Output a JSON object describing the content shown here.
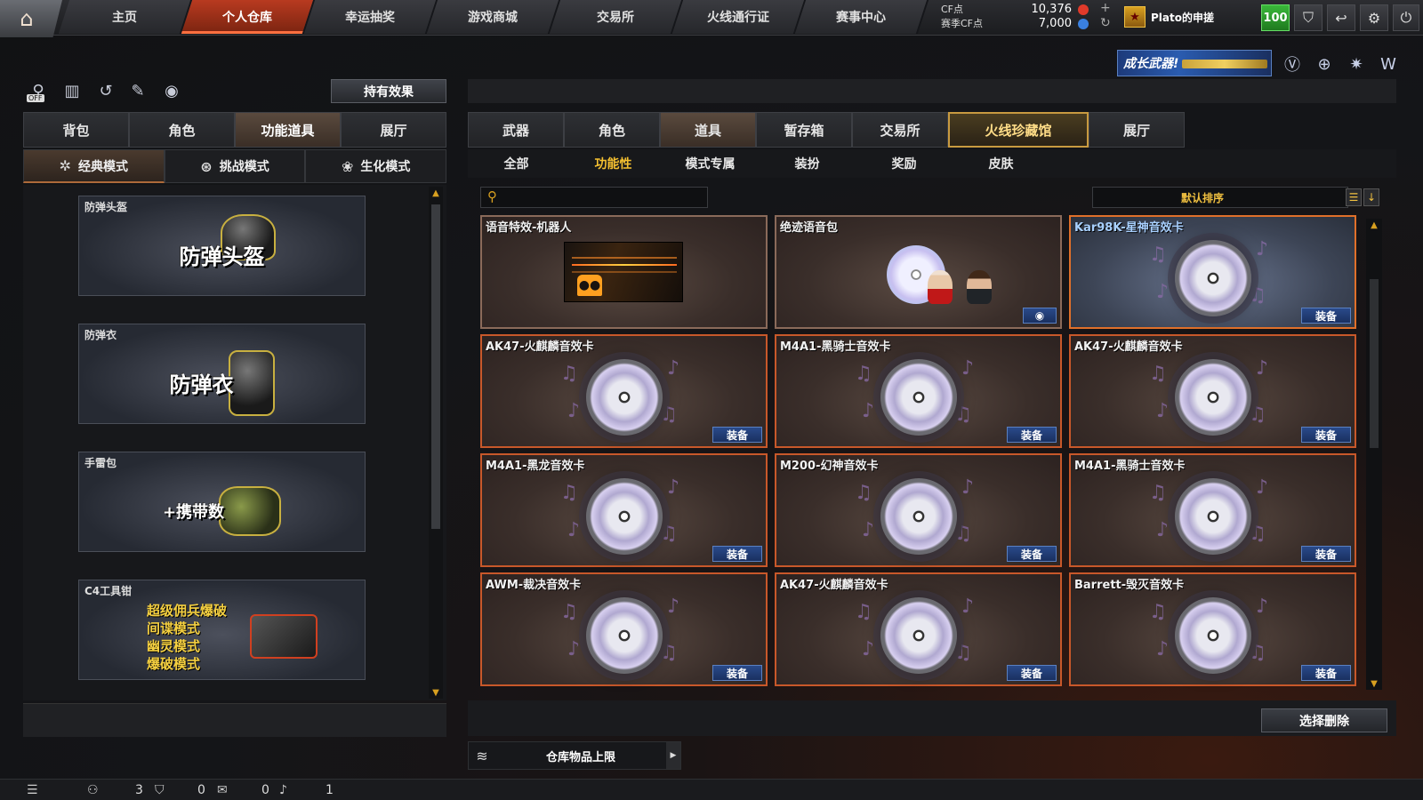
{
  "nav": {
    "tabs": [
      "主页",
      "个人仓库",
      "幸运抽奖",
      "游戏商城",
      "交易所",
      "火线通行证",
      "赛事中心"
    ],
    "active_tab": "个人仓库"
  },
  "currency": {
    "cf_label": "CF点",
    "season_cf_label": "赛季CF点",
    "cf_value": "10,376",
    "season_cf_value": "7,000"
  },
  "player": {
    "name": "Plato的申搓",
    "level": "100"
  },
  "icons": {
    "home": "home-icon",
    "shield": "shield-icon",
    "return": "return-icon",
    "settings": "gear-icon",
    "power": "power-icon",
    "search": "search-icon"
  },
  "growth_banner": {
    "label": "成长武器!"
  },
  "left": {
    "off_label": "OFF",
    "hold_effect": "持有效果",
    "tabs": [
      "背包",
      "角色",
      "功能道具",
      "展厅"
    ],
    "active_tab": "功能道具",
    "modes": [
      "经典模式",
      "挑战模式",
      "生化模式"
    ],
    "active_mode": "经典模式",
    "items": [
      {
        "label": "防弹头盔",
        "art_title": "防弹头盔"
      },
      {
        "label": "防弹衣",
        "art_title": "防弹衣"
      },
      {
        "label": "手雷包",
        "art_title": "+携带数"
      },
      {
        "label": "C4工具钳",
        "art_lines": [
          "超级佣兵爆破",
          "间谍模式",
          "幽灵模式",
          "爆破模式"
        ]
      }
    ]
  },
  "right": {
    "tabs": [
      "武器",
      "角色",
      "道具",
      "暂存箱",
      "交易所",
      "火线珍藏馆",
      "展厅"
    ],
    "active_tab": "道具",
    "sub_tabs": [
      "全部",
      "功能性",
      "模式专属",
      "装扮",
      "奖励",
      "皮肤"
    ],
    "active_sub_tab": "功能性",
    "search_placeholder": "",
    "sort_label": "默认排序",
    "equip_label": "装备",
    "delete_label": "选择删除",
    "capacity_label": "仓库物品上限",
    "cards": [
      {
        "title": "语音特效-机器人",
        "art": "robot",
        "equip": false
      },
      {
        "title": "绝迹语音包",
        "art": "voice",
        "equip": false
      },
      {
        "title": "Kar98K-星神音效卡",
        "art": "disc",
        "equip": true
      },
      {
        "title": "AK47-火麒麟音效卡",
        "art": "disc",
        "equip": true
      },
      {
        "title": "M4A1-黑骑士音效卡",
        "art": "disc",
        "equip": true
      },
      {
        "title": "AK47-火麒麟音效卡",
        "art": "disc",
        "equip": true
      },
      {
        "title": "M4A1-黑龙音效卡",
        "art": "disc",
        "equip": true
      },
      {
        "title": "M200-幻神音效卡",
        "art": "disc",
        "equip": true
      },
      {
        "title": "M4A1-黑骑士音效卡",
        "art": "disc",
        "equip": true
      },
      {
        "title": "AWM-裁决音效卡",
        "art": "disc",
        "equip": true
      },
      {
        "title": "AK47-火麒麟音效卡",
        "art": "disc",
        "equip": true
      },
      {
        "title": "Barrett-毁灭音效卡",
        "art": "disc",
        "equip": true
      }
    ]
  },
  "status": {
    "count1": "3",
    "count2": "0",
    "count3": "0",
    "count4": "1"
  },
  "colors": {
    "accent_orange": "#c8582a",
    "active_tab_red": "#b83a20",
    "gold_text": "#f5c030",
    "equip_blue": "#2a4a8a",
    "level_green": "#3ab83a"
  }
}
